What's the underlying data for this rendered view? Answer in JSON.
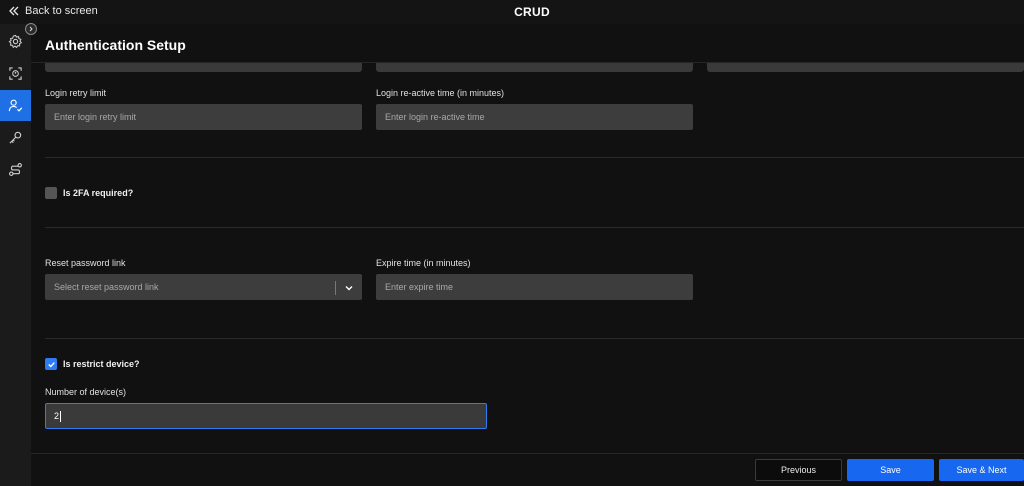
{
  "topbar": {
    "back_label": "Back to screen",
    "title": "CRUD"
  },
  "sidebar": {
    "items": [
      {
        "icon": "gear-cog-icon"
      },
      {
        "icon": "face-scan-icon"
      },
      {
        "icon": "user-check-icon"
      },
      {
        "icon": "key-icon"
      },
      {
        "icon": "route-icon"
      }
    ],
    "active_index": 2,
    "accent": "#1f6fe5"
  },
  "page": {
    "title": "Authentication Setup"
  },
  "form": {
    "login_retry": {
      "label": "Login retry limit",
      "placeholder": "Enter login retry limit"
    },
    "login_reactive": {
      "label": "Login re-active time (in minutes)",
      "placeholder": "Enter login re-active time"
    },
    "twofa": {
      "label": "Is 2FA required?",
      "checked": false
    },
    "reset_link": {
      "label": "Reset password link",
      "placeholder": "Select reset password link"
    },
    "expire_time": {
      "label": "Expire time (in minutes)",
      "placeholder": "Enter expire time"
    },
    "restrict_device": {
      "label": "Is restrict device?",
      "checked": true
    },
    "num_devices": {
      "label": "Number of device(s)",
      "value": "2"
    }
  },
  "footer": {
    "previous": "Previous",
    "save": "Save",
    "save_next": "Save & Next"
  },
  "colors": {
    "primary": "#1767f0",
    "background": "#111111",
    "field": "#3d3d3d"
  }
}
